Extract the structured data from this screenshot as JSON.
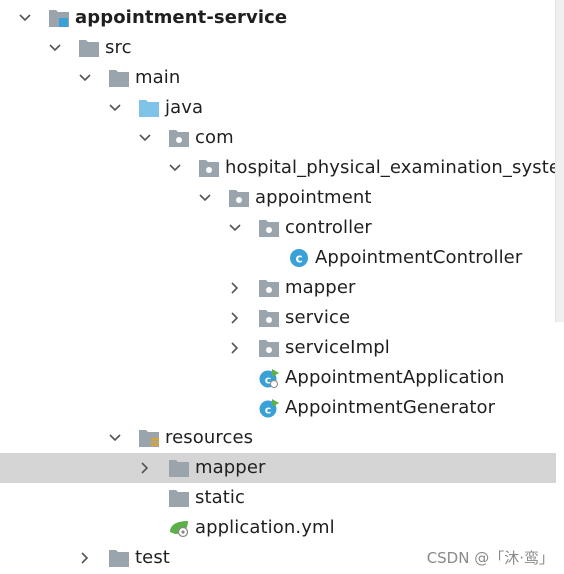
{
  "tree": {
    "root": "appointment-service",
    "src": "src",
    "main": "main",
    "java": "java",
    "com": "com",
    "hps": "hospital_physical_examination_system",
    "appointment": "appointment",
    "controller": "controller",
    "appointment_controller": "AppointmentController",
    "mapper": "mapper",
    "service": "service",
    "service_impl": "serviceImpl",
    "appointment_application": "AppointmentApplication",
    "appointment_generator": "AppointmentGenerator",
    "resources": "resources",
    "res_mapper": "mapper",
    "static": "static",
    "application_yml": "application.yml",
    "test": "test"
  },
  "icons": {
    "folder": "folder-icon",
    "package": "package-icon",
    "java_source_folder": "java-folder-icon",
    "resources_folder": "resources-folder-icon",
    "module": "module-icon",
    "class": "class-icon",
    "spring_boot_class": "spring-boot-class-icon",
    "yaml": "yaml-file-icon"
  },
  "colors": {
    "folder": "#9aa4ad",
    "java_folder": "#7fc4e8",
    "class_circle": "#3aa0d8",
    "spring_leaf": "#5bb04a",
    "selection": "#d5d5d5"
  },
  "watermark": "CSDN @「沐·鸾」"
}
